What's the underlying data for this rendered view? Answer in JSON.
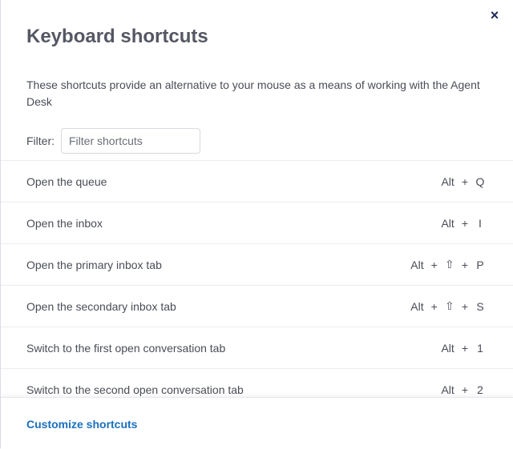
{
  "modal": {
    "title": "Keyboard shortcuts",
    "close_icon": "×",
    "description": "These shortcuts provide an alternative to your mouse as a means of working with the Agent Desk",
    "filter": {
      "label": "Filter:",
      "placeholder": "Filter shortcuts",
      "value": ""
    },
    "shortcuts": [
      {
        "label": "Open the queue",
        "keys": [
          "Alt",
          "Q"
        ]
      },
      {
        "label": "Open the inbox",
        "keys": [
          "Alt",
          "I"
        ]
      },
      {
        "label": "Open the primary inbox tab",
        "keys": [
          "Alt",
          "⇧",
          "P"
        ]
      },
      {
        "label": "Open the secondary inbox tab",
        "keys": [
          "Alt",
          "⇧",
          "S"
        ]
      },
      {
        "label": "Switch to the first open conversation tab",
        "keys": [
          "Alt",
          "1"
        ]
      },
      {
        "label": "Switch to the second open conversation tab",
        "keys": [
          "Alt",
          "2"
        ]
      }
    ],
    "key_separator": "+",
    "footer": {
      "customize_label": "Customize shortcuts"
    }
  },
  "colors": {
    "link": "#1a6fbf",
    "close_icon": "#1f2b5c",
    "title": "#555863"
  }
}
